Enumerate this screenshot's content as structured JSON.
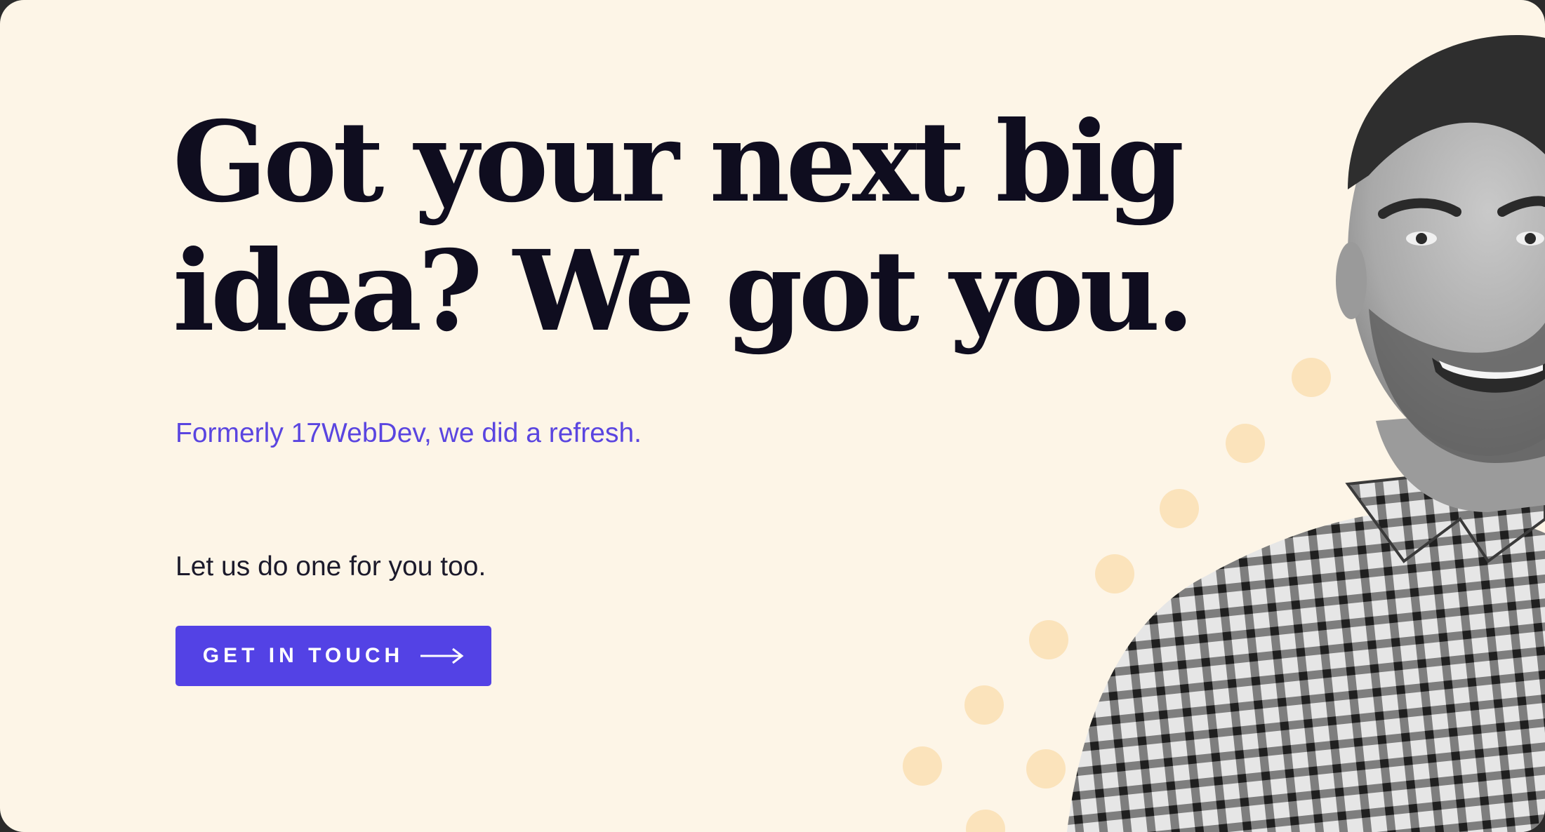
{
  "hero": {
    "headline_line1": "Got your next big",
    "headline_line2": "idea? We got you.",
    "subtitle": "Formerly 17WebDev, we did a refresh.",
    "tagline": "Let us do one for you too.",
    "cta_label": "GET IN TOUCH",
    "cta_icon": "arrow-right-icon",
    "photo_alt": "portrait-photo"
  },
  "colors": {
    "background": "#fdf5e7",
    "headline": "#0f0d1f",
    "accent": "#5342e5",
    "subtitle": "#5a45e0",
    "dots": "#fbe3bb"
  }
}
